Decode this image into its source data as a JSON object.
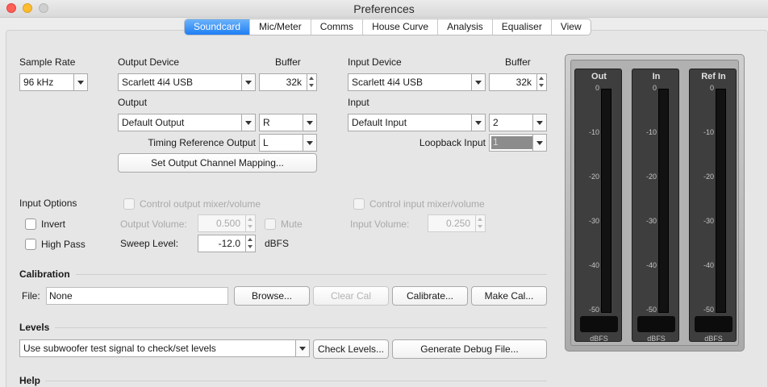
{
  "window": {
    "title": "Preferences"
  },
  "tabs": [
    {
      "label": "Soundcard",
      "active": true
    },
    {
      "label": "Mic/Meter"
    },
    {
      "label": "Comms"
    },
    {
      "label": "House Curve"
    },
    {
      "label": "Analysis"
    },
    {
      "label": "Equaliser"
    },
    {
      "label": "View"
    }
  ],
  "sample_rate": {
    "label": "Sample Rate",
    "value": "96 kHz"
  },
  "output_device": {
    "label": "Output Device",
    "value": "Scarlett 4i4 USB",
    "buffer_label": "Buffer",
    "buffer_value": "32k",
    "output_label": "Output",
    "output_value": "Default Output",
    "channel_value": "R",
    "timing_label": "Timing Reference Output",
    "timing_value": "L",
    "mapping_button": "Set Output Channel Mapping..."
  },
  "input_device": {
    "label": "Input Device",
    "value": "Scarlett 4i4 USB",
    "buffer_label": "Buffer",
    "buffer_value": "32k",
    "input_label": "Input",
    "input_value": "Default Input",
    "channel_value": "2",
    "loopback_label": "Loopback Input",
    "loopback_value": "1"
  },
  "input_options": {
    "label": "Input Options",
    "invert": "Invert",
    "high_pass": "High Pass"
  },
  "output_mixer": {
    "control_label": "Control output mixer/volume",
    "volume_label": "Output Volume:",
    "volume_value": "0.500",
    "mute_label": "Mute"
  },
  "input_mixer": {
    "control_label": "Control input mixer/volume",
    "volume_label": "Input Volume:",
    "volume_value": "0.250"
  },
  "sweep": {
    "label": "Sweep Level:",
    "value": "-12.0",
    "unit": "dBFS"
  },
  "calibration": {
    "header": "Calibration",
    "file_label": "File:",
    "file_value": "None",
    "browse": "Browse...",
    "clear": "Clear Cal",
    "calibrate": "Calibrate...",
    "make": "Make Cal..."
  },
  "levels": {
    "header": "Levels",
    "mode_value": "Use subwoofer test signal to check/set levels",
    "check": "Check Levels...",
    "debug": "Generate Debug File..."
  },
  "help": {
    "header": "Help"
  },
  "meters": {
    "columns": [
      "Out",
      "In",
      "Ref In"
    ],
    "ticks": [
      "0",
      "-10",
      "-20",
      "-30",
      "-40",
      "-50"
    ],
    "unit": "dBFS"
  }
}
